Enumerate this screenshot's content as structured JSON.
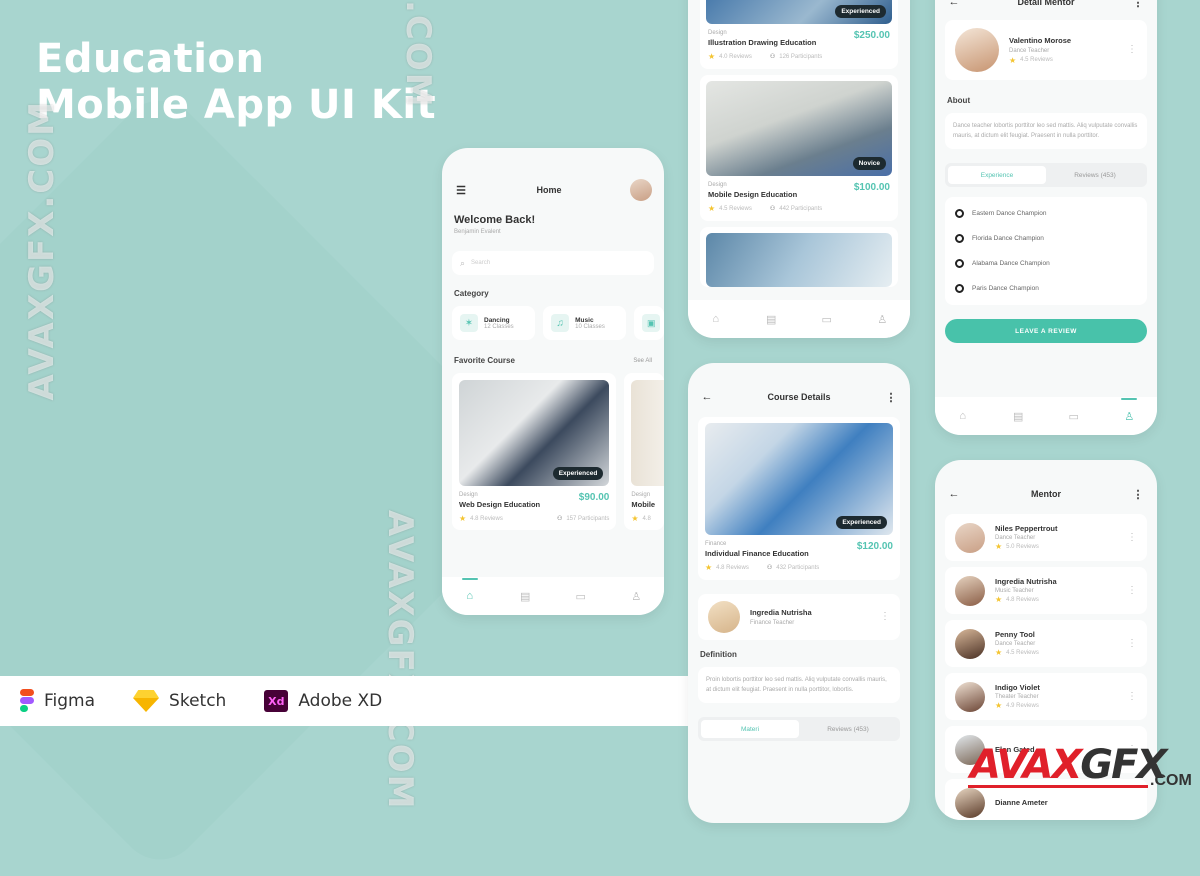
{
  "hero": {
    "line1": "Education",
    "line2": "Mobile App UI Kit"
  },
  "tools": [
    {
      "name": "Figma"
    },
    {
      "name": "Sketch"
    },
    {
      "name": "Adobe XD",
      "icon_text": "Xd"
    }
  ],
  "watermarks": {
    "left": "AVAXGFX.COM",
    "top": ".COM",
    "mid": "AVAXGFX.COM",
    "logo_main": "AVAXGFX",
    "logo_sub": ".COM"
  },
  "home": {
    "title": "Home",
    "welcome": "Welcome Back!",
    "user": "Benjamin Evalent",
    "search_placeholder": "Search",
    "category_title": "Category",
    "categories": [
      {
        "label": "Dancing",
        "sub": "12 Classes",
        "icon": "dance-icon"
      },
      {
        "label": "Music",
        "sub": "10 Classes",
        "icon": "music-icon"
      }
    ],
    "favorite_title": "Favorite Course",
    "see_all": "See All",
    "course": {
      "category": "Design",
      "title": "Web Design Education",
      "price": "$90.00",
      "rating": "4.8 Reviews",
      "participants": "157 Participants",
      "level": "Experienced"
    },
    "course2": {
      "category": "Design",
      "title": "Mobile",
      "rating": "4.8"
    }
  },
  "list": {
    "courses": [
      {
        "category": "Design",
        "title": "Illustration Drawing Education",
        "price": "$250.00",
        "rating": "4.0 Reviews",
        "participants": "126 Participants",
        "level": "Experienced"
      },
      {
        "category": "Design",
        "title": "Mobile Design Education",
        "price": "$100.00",
        "rating": "4.5 Reviews",
        "participants": "442 Participants",
        "level": "Novice"
      }
    ]
  },
  "details": {
    "title": "Course Details",
    "course": {
      "category": "Finance",
      "title": "Individual Finance Education",
      "price": "$120.00",
      "rating": "4.8 Reviews",
      "participants": "432 Participants",
      "level": "Experienced"
    },
    "teacher": {
      "name": "Ingredia Nutrisha",
      "role": "Finance Teacher"
    },
    "definition_title": "Definition",
    "definition": "Proin lobortis porttitor leo sed mattis. Aliq vulputate convallis mauris, at dictum elit feugiat. Praesent in nulla porttitor, lobortis.",
    "tabs": [
      "Materi",
      "Reviews (453)"
    ]
  },
  "detail_mentor": {
    "title": "Detail Mentor",
    "mentor": {
      "name": "Valentino Morose",
      "role": "Dance Teacher",
      "rating": "4.5 Reviews"
    },
    "about_title": "About",
    "about": "Dance teacher lobortis porttitor leo sed mattis. Aliq vulputate convallis mauris, at dictum elit feugiat. Praesent in nulla porttitor.",
    "tabs": [
      "Experience",
      "Reviews (453)"
    ],
    "experience": [
      "Eastern Dance Champion",
      "Florida Dance Champion",
      "Alabama Dance Champion",
      "Paris Dance Champion"
    ],
    "cta": "LEAVE A REVIEW"
  },
  "mentors": {
    "title": "Mentor",
    "items": [
      {
        "name": "Niles Peppertrout",
        "role": "Dance Teacher",
        "rating": "5.0 Reviews"
      },
      {
        "name": "Ingredia Nutrisha",
        "role": "Music Teacher",
        "rating": "4.8 Reviews"
      },
      {
        "name": "Penny Tool",
        "role": "Dance Teacher",
        "rating": "4.5 Reviews"
      },
      {
        "name": "Indigo Violet",
        "role": "Theater Teacher",
        "rating": "4.9 Reviews"
      },
      {
        "name": "Elon Gated",
        "role": "",
        "rating": ""
      },
      {
        "name": "Dianne Ameter",
        "role": "",
        "rating": ""
      }
    ]
  },
  "colors": {
    "accent": "#55c4b2",
    "background": "#a8d5cf",
    "badge": "#1d2a30",
    "star": "#f4c430"
  }
}
